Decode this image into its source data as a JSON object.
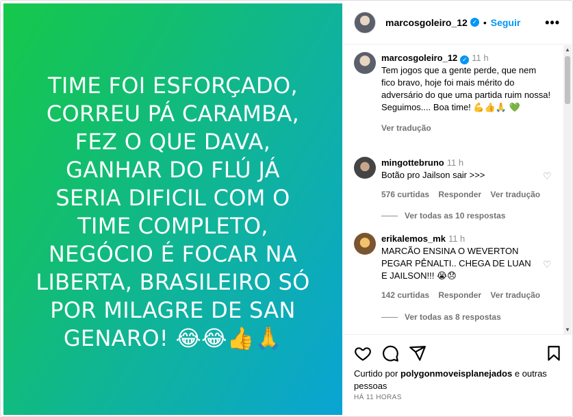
{
  "post": {
    "image_text_lines": [
      "TIME FOI ESFORÇADO,",
      "CORREU PÁ CARAMBA,",
      "FEZ O QUE DAVA,",
      "GANHAR DO FLÚ JÁ",
      "SERIA DIFICIL COM O",
      "TIME COMPLETO,",
      "NEGÓCIO É FOCAR NA",
      "LIBERTA, BRASILEIRO SÓ",
      "POR MILAGRE DE SAN",
      "GENARO! 😂😂👍🙏"
    ]
  },
  "header": {
    "username": "marcosgoleiro_12",
    "separator": "•",
    "follow_label": "Seguir",
    "more_label": "•••"
  },
  "caption": {
    "username": "marcosgoleiro_12",
    "time": "11 h",
    "text": "Tem jogos que a gente perde, que nem fico bravo, hoje foi mais mérito do adversário do que uma partida ruim nossa! Seguimos.... Boa time! 💪👍🙏 💚",
    "translate_label": "Ver tradução"
  },
  "comments": [
    {
      "username": "mingottebruno",
      "time": "11 h",
      "text": "Botão pro Jailson sair >>>",
      "likes": "576 curtidas",
      "reply_label": "Responder",
      "translate_label": "Ver tradução",
      "replies_label": "Ver todas as 10 respostas"
    },
    {
      "username": "erikalemos_mk",
      "time": "11 h",
      "text": "MARCÃO ENSINA O WEVERTON PEGAR PÊNALTI.. CHEGA DE LUAN E JAILSON!!! 😭😞",
      "likes": "142 curtidas",
      "reply_label": "Responder",
      "translate_label": "Ver tradução",
      "replies_label": "Ver todas as 8 respostas"
    }
  ],
  "footer": {
    "liked_prefix": "Curtido por",
    "liked_user": "polygonmoveisplanejados",
    "liked_suffix": "e outras pessoas",
    "timestamp": "HÁ 11 HORAS"
  },
  "colors": {
    "accent": "#0095f6",
    "gradient_start": "#16c84a",
    "gradient_end": "#0aa4d4"
  }
}
